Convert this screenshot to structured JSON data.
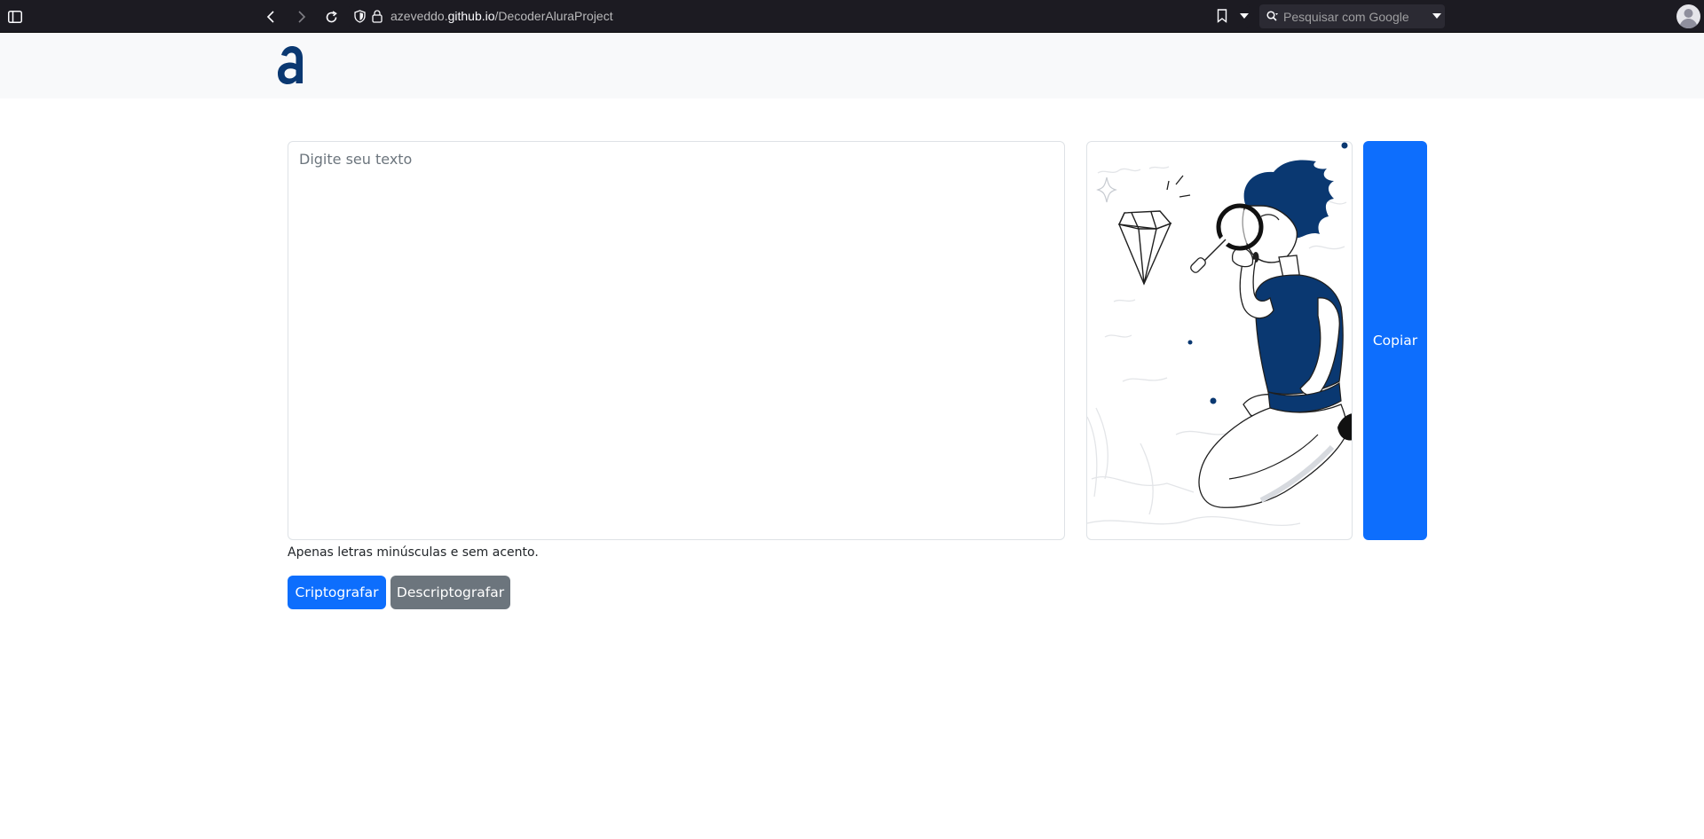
{
  "browser": {
    "url_domain_prefix": "azeveddo.",
    "url_domain_main": "github.io",
    "url_path": "/DecoderAluraProject",
    "search_placeholder": "Pesquisar com Google"
  },
  "page": {
    "logo_icon": "alura-logo",
    "textarea_placeholder": "Digite seu texto",
    "hint": "Apenas letras minúsculas e sem acento.",
    "encrypt_label": "Criptografar",
    "decrypt_label": "Descriptografar",
    "copy_label": "Copiar",
    "illustration_icon": "person-with-magnifying-glass-illustration"
  },
  "colors": {
    "primary": "#0d6efd",
    "secondary": "#6c757d",
    "brand": "#0a3871"
  }
}
